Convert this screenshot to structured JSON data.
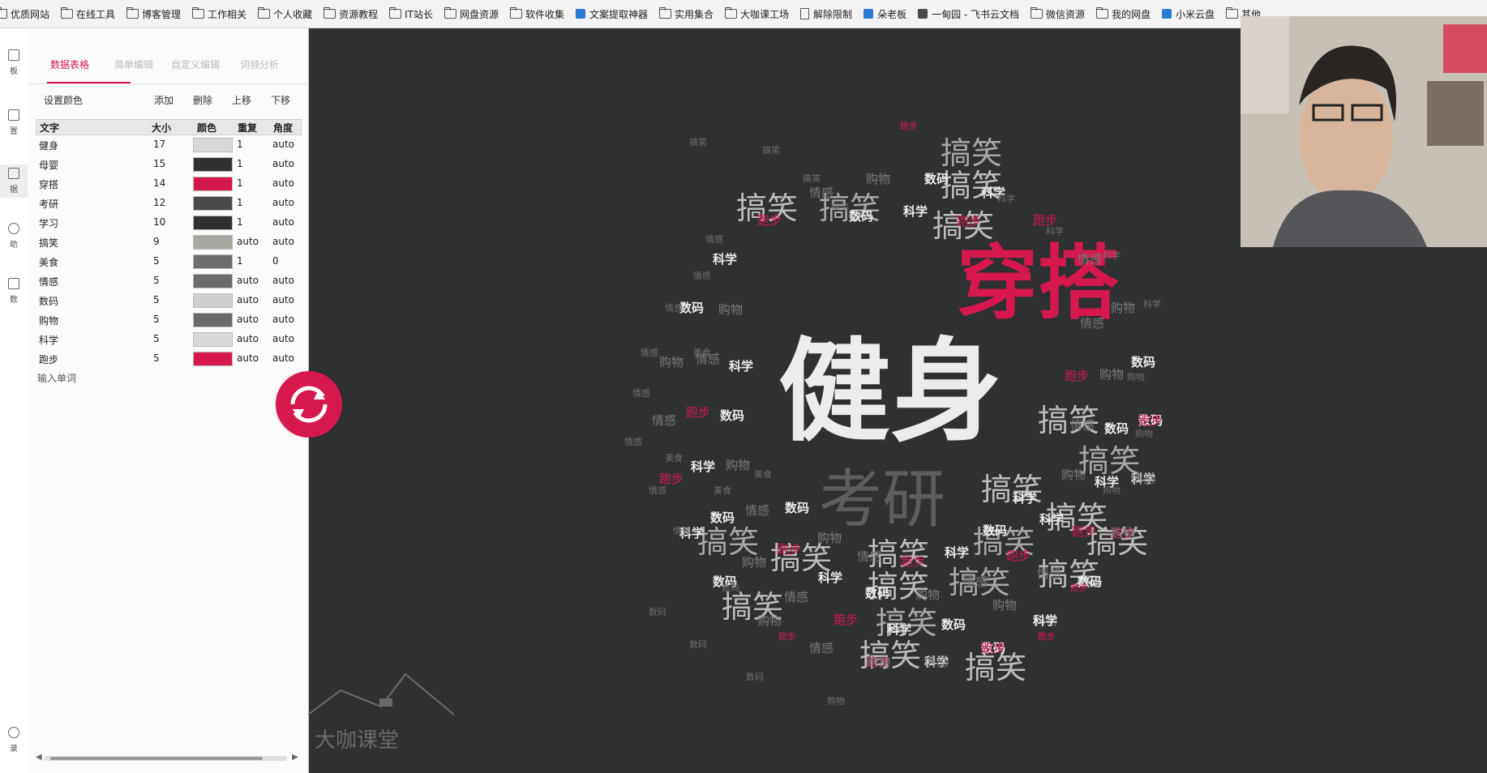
{
  "bookmarks": [
    {
      "label": "优质网站",
      "icon": "folder-icon"
    },
    {
      "label": "在线工具",
      "icon": "folder-icon"
    },
    {
      "label": "博客管理",
      "icon": "folder-icon"
    },
    {
      "label": "工作相关",
      "icon": "folder-icon"
    },
    {
      "label": "个人收藏",
      "icon": "folder-icon"
    },
    {
      "label": "资源教程",
      "icon": "folder-icon"
    },
    {
      "label": "IT站长",
      "icon": "folder-icon"
    },
    {
      "label": "网盘资源",
      "icon": "folder-icon"
    },
    {
      "label": "软件收集",
      "icon": "folder-icon"
    },
    {
      "label": "文案提取神器",
      "icon": "app-icon"
    },
    {
      "label": "实用集合",
      "icon": "folder-icon"
    },
    {
      "label": "大咖课工场",
      "icon": "folder-icon"
    },
    {
      "label": "解除限制",
      "icon": "document-icon"
    },
    {
      "label": "朵老板",
      "icon": "app-icon"
    },
    {
      "label": "一甸园 - 飞书云文档",
      "icon": "app-icon"
    },
    {
      "label": "微信资源",
      "icon": "folder-icon"
    },
    {
      "label": "我的网盘",
      "icon": "folder-icon"
    },
    {
      "label": "小米云盘",
      "icon": "app-icon"
    },
    {
      "label": "其他",
      "icon": "folder-icon"
    }
  ],
  "strip": [
    "板",
    "置",
    "据",
    "助",
    "数",
    "录"
  ],
  "tabs": [
    "数据表格",
    "简单编辑",
    "自定义编辑",
    "词频分析"
  ],
  "toolbar": {
    "set_color": "设置颜色",
    "add": "添加",
    "delete": "删除",
    "up": "上移",
    "down": "下移"
  },
  "columns": [
    "文字",
    "大小",
    "颜色",
    "重复",
    "角度"
  ],
  "rows": [
    {
      "text": "健身",
      "size": "17",
      "color": "#d8d8d8",
      "repeat": "1",
      "angle": "auto"
    },
    {
      "text": "母婴",
      "size": "15",
      "color": "#2e3032",
      "repeat": "1",
      "angle": "auto"
    },
    {
      "text": "穿搭",
      "size": "14",
      "color": "#d6184f",
      "repeat": "1",
      "angle": "auto"
    },
    {
      "text": "考研",
      "size": "12",
      "color": "#4b4b4b",
      "repeat": "1",
      "angle": "auto"
    },
    {
      "text": "学习",
      "size": "10",
      "color": "#2e3032",
      "repeat": "1",
      "angle": "auto"
    },
    {
      "text": "搞笑",
      "size": "9",
      "color": "#a8a7a2",
      "repeat": "auto",
      "angle": "auto"
    },
    {
      "text": "美食",
      "size": "5",
      "color": "#6d6d6b",
      "repeat": "1",
      "angle": "0"
    },
    {
      "text": "情感",
      "size": "5",
      "color": "#6b6b6a",
      "repeat": "auto",
      "angle": "auto"
    },
    {
      "text": "数码",
      "size": "5",
      "color": "#cfcfcf",
      "repeat": "auto",
      "angle": "auto"
    },
    {
      "text": "购物",
      "size": "5",
      "color": "#6a6a6a",
      "repeat": "auto",
      "angle": "auto"
    },
    {
      "text": "科学",
      "size": "5",
      "color": "#d8d8d8",
      "repeat": "auto",
      "angle": "auto"
    },
    {
      "text": "跑步",
      "size": "5",
      "color": "#d6184f",
      "repeat": "auto",
      "angle": "auto"
    }
  ],
  "input_placeholder": "输入单词",
  "watermark": "大咖课堂",
  "colors": {
    "accent": "#d6184f",
    "cloud_bg": "#2f3032",
    "light": "#ececec",
    "grey": "#a8a7a2",
    "dark_grey": "#6e6e6e"
  },
  "cloud_words": {
    "big": [
      "健身",
      "穿搭",
      "考研"
    ],
    "mid": [
      "搞笑",
      "搞笑",
      "搞笑",
      "搞笑",
      "搞笑",
      "搞笑",
      "搞笑",
      "搞笑",
      "搞笑",
      "搞笑",
      "搞笑",
      "搞笑",
      "搞笑",
      "搞笑",
      "搞笑",
      "搞笑",
      "搞笑",
      "搞笑",
      "搞笑",
      "搞笑",
      "搞笑"
    ],
    "small": [
      "数码",
      "科学",
      "跑步",
      "情感",
      "购物",
      "数码",
      "科学",
      "跑步",
      "情感",
      "购物",
      "数码",
      "科学",
      "跑步",
      "情感",
      "购物",
      "数码",
      "科学",
      "跑步",
      "情感",
      "购物",
      "数码",
      "科学",
      "跑步",
      "情感",
      "购物",
      "数码",
      "科学",
      "跑步",
      "情感",
      "购物",
      "数码",
      "科学",
      "跑步",
      "情感",
      "购物",
      "数码",
      "科学",
      "跑步",
      "情感",
      "购物",
      "数码",
      "科学",
      "跑步",
      "情感",
      "购物",
      "数码",
      "科学",
      "跑步",
      "情感",
      "购物",
      "数码",
      "科学",
      "跑步",
      "情感",
      "购物",
      "数码",
      "科学",
      "跑步",
      "情感",
      "购物",
      "数码",
      "科学",
      "跑步",
      "情感",
      "购物",
      "数码",
      "科学",
      "跑步",
      "情感",
      "购物",
      "数码",
      "科学",
      "跑步",
      "情感",
      "购物"
    ],
    "tiny": [
      "搞笑",
      "搞笑",
      "搞笑",
      "搞笑",
      "情感",
      "情感",
      "情感",
      "情感",
      "情感",
      "情感",
      "情感",
      "情感",
      "数码",
      "数码",
      "数码",
      "数码",
      "购物",
      "购物",
      "购物",
      "购物",
      "科学",
      "科学",
      "科学",
      "科学",
      "跑步",
      "跑步",
      "跑步",
      "跑步",
      "美食",
      "美食",
      "美食",
      "美食"
    ]
  }
}
